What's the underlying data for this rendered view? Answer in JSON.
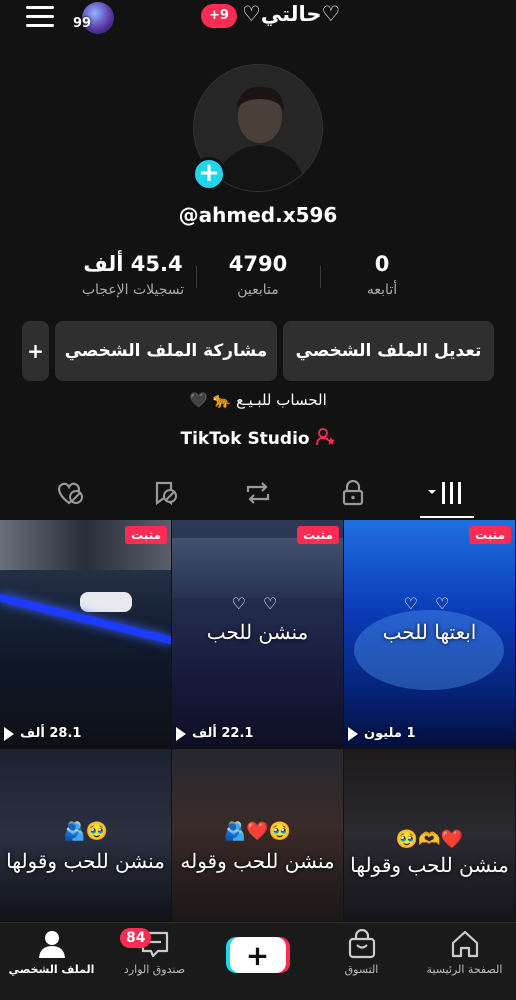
{
  "header": {
    "title": "♡حالتي♡",
    "notif_badge": "+9",
    "avatar_badge": "99"
  },
  "profile": {
    "username": "@ahmed.x596",
    "bio": "الحساب للبـيـع 🐆 🖤",
    "studio_label": "TikTok Studio"
  },
  "stats": [
    {
      "value": "0",
      "label": "أتابعه"
    },
    {
      "value": "4790",
      "label": "متابعين"
    },
    {
      "value": "45.4 ألف",
      "label": "تسجيلات الإعجاب"
    }
  ],
  "buttons": {
    "edit": "تعديل الملف الشخصي",
    "share": "مشاركة الملف الشخصي",
    "add_friend": "+"
  },
  "tabs": [
    {
      "icon": "videos-grid-icon",
      "active": true
    },
    {
      "icon": "lock-icon",
      "active": false
    },
    {
      "icon": "repost-icon",
      "active": false
    },
    {
      "icon": "hidden-favorites-icon",
      "active": false
    },
    {
      "icon": "hidden-likes-icon",
      "active": false
    }
  ],
  "videos": [
    {
      "pinned_label": "مثبت",
      "views": "1 مليون",
      "text": "ابعتها للحب",
      "hearts": "♡ ♡",
      "emoji": ""
    },
    {
      "pinned_label": "مثبت",
      "views": "22.1 ألف",
      "text": "منشن للحب",
      "hearts": "♡ ♡",
      "emoji": ""
    },
    {
      "pinned_label": "مثبت",
      "views": "28.1 ألف",
      "text": "",
      "hearts": "",
      "emoji": ""
    },
    {
      "pinned_label": "",
      "views": "",
      "text": "منشن للحب وقولها",
      "hearts": "",
      "emoji": "🥹🫶❤️"
    },
    {
      "pinned_label": "",
      "views": "",
      "text": "منشن للحب وقوله",
      "hearts": "",
      "emoji": "🫂❤️🥹"
    },
    {
      "pinned_label": "",
      "views": "",
      "text": "منشن للحب وقولها",
      "hearts": "",
      "emoji": "🫂🥹"
    }
  ],
  "bottom_nav": {
    "home": "الصفحة الرئيسية",
    "shop": "التسوق",
    "create": "+",
    "inbox": "صندوق الوارد",
    "inbox_badge": "84",
    "profile": "الملف الشخصي"
  },
  "colors": {
    "accent_red": "#fe2c55",
    "accent_cyan": "#20d5ec",
    "background": "#121212"
  }
}
